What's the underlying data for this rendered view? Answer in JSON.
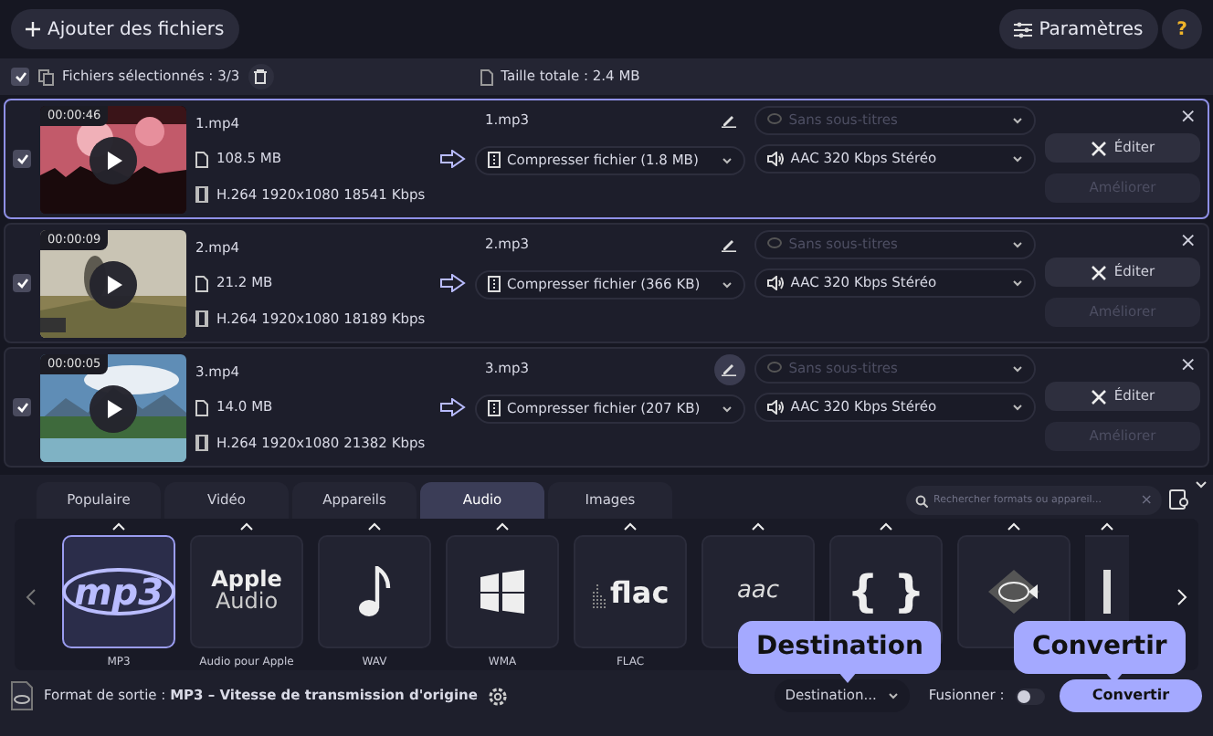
{
  "toolbar": {
    "add_button": "Ajouter des fichiers",
    "settings_button": "Paramètres",
    "help_button": "?"
  },
  "selection_bar": {
    "checked": true,
    "selected_label": "Fichiers sélectionnés : 3/3",
    "total_label": "Taille totale : 2.4 MB"
  },
  "files": [
    {
      "checked": true,
      "selected": true,
      "duration": "00:00:46",
      "name": "1.mp4",
      "size": "108.5 MB",
      "codec": "H.264 1920x1080 18541 Kbps",
      "output_name": "1.mp3",
      "pencil_highlighted": false,
      "compress": "Compresser fichier (1.8 MB)",
      "subtitles": "Sans sous-titres",
      "audio": "AAC 320 Kbps Stéréo",
      "edit_button": "Éditer",
      "enhance_button": "Améliorer",
      "close": "×"
    },
    {
      "checked": true,
      "selected": false,
      "duration": "00:00:09",
      "name": "2.mp4",
      "size": "21.2 MB",
      "codec": "H.264 1920x1080 18189 Kbps",
      "output_name": "2.mp3",
      "pencil_highlighted": false,
      "compress": "Compresser fichier (366 KB)",
      "subtitles": "Sans sous-titres",
      "audio": "AAC 320 Kbps Stéréo",
      "edit_button": "Éditer",
      "enhance_button": "Améliorer",
      "close": "×"
    },
    {
      "checked": true,
      "selected": false,
      "duration": "00:00:05",
      "name": "3.mp4",
      "size": "14.0 MB",
      "codec": "H.264 1920x1080 21382 Kbps",
      "output_name": "3.mp3",
      "pencil_highlighted": true,
      "compress": "Compresser fichier (207 KB)",
      "subtitles": "Sans sous-titres",
      "audio": "AAC 320 Kbps Stéréo",
      "edit_button": "Éditer",
      "enhance_button": "Améliorer",
      "close": "×"
    }
  ],
  "tabs": [
    {
      "label": "Populaire",
      "selected": false
    },
    {
      "label": "Vidéo",
      "selected": false
    },
    {
      "label": "Appareils",
      "selected": false
    },
    {
      "label": "Audio",
      "selected": true
    },
    {
      "label": "Images",
      "selected": false
    }
  ],
  "search": {
    "placeholder": "Rechercher formats ou appareil...",
    "clear": "×"
  },
  "formats": [
    {
      "kind": "mp3",
      "logo_text": "mp3",
      "label": "MP3",
      "selected": true
    },
    {
      "kind": "apple",
      "logo_text": "Apple",
      "logo_subtext": "Audio",
      "label": "Audio pour Apple",
      "selected": false
    },
    {
      "kind": "note",
      "label": "WAV",
      "selected": false
    },
    {
      "kind": "windows",
      "label": "WMA",
      "selected": false
    },
    {
      "kind": "flac",
      "logo_text": "flac",
      "label": "FLAC",
      "selected": false
    },
    {
      "kind": "aac",
      "logo_text": "aac",
      "selected": false
    },
    {
      "kind": "braces",
      "logo_text": "{ }",
      "selected": false
    },
    {
      "kind": "fish",
      "selected": false
    },
    {
      "kind": "partial",
      "selected": false
    }
  ],
  "output": {
    "text": "Format de sortie : **MP3 – Vitesse de transmission d'origine**",
    "destination": "Destination...",
    "merge_label": "Fusionner :",
    "merge_on": false,
    "convert_button": "Convertir"
  },
  "callouts": [
    {
      "kind": "destination",
      "text": "Destination"
    },
    {
      "kind": "convert",
      "text": "Convertir"
    }
  ]
}
